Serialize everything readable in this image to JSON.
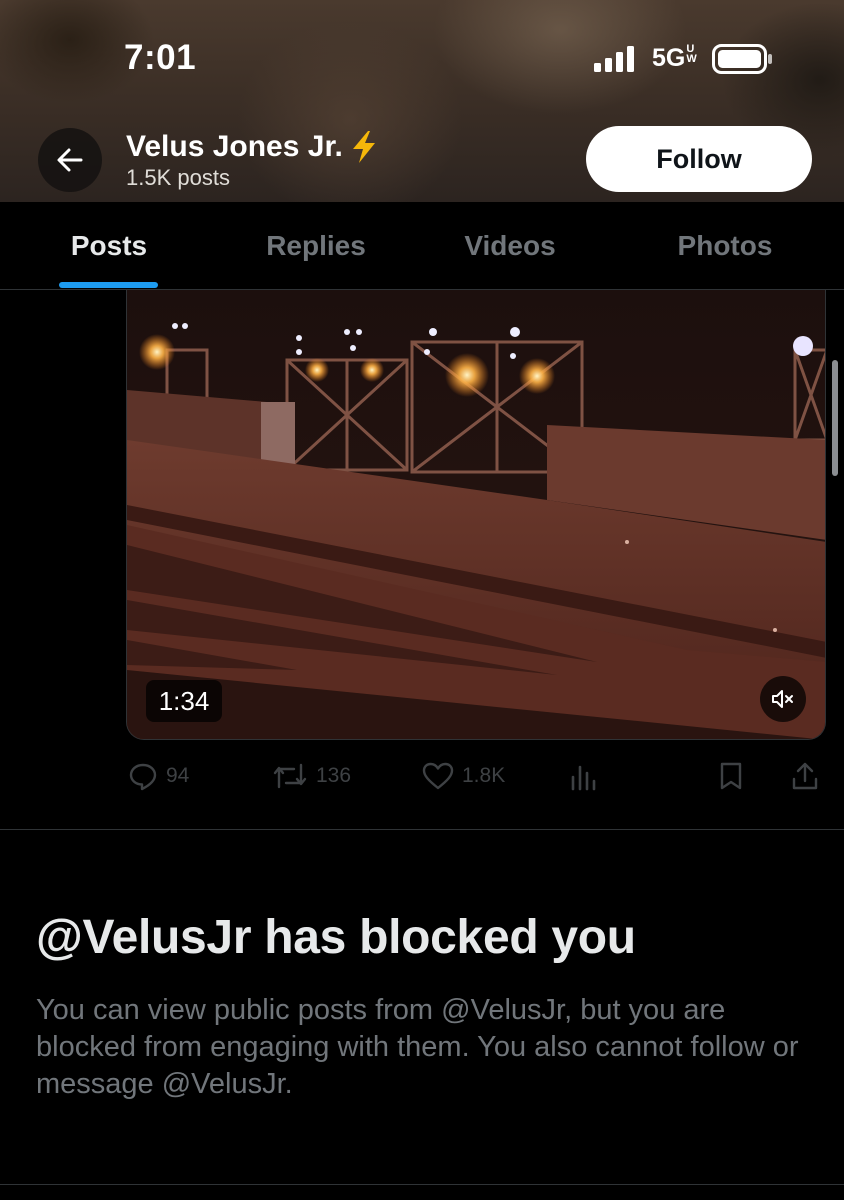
{
  "status_bar": {
    "time": "7:01",
    "network": "5G",
    "network_suffix": "UW"
  },
  "profile": {
    "name": "Velus Jones Jr.",
    "name_emoji": "⚡",
    "posts_count": "1.5K posts",
    "follow_label": "Follow"
  },
  "tabs": [
    {
      "label": "Posts",
      "active": true
    },
    {
      "label": "Replies",
      "active": false
    },
    {
      "label": "Videos",
      "active": false
    },
    {
      "label": "Photos",
      "active": false
    }
  ],
  "video": {
    "duration": "1:34",
    "muted": true
  },
  "actions": {
    "replies": "94",
    "reposts": "136",
    "likes": "1.8K"
  },
  "blocked": {
    "title": "@VelusJr has blocked you",
    "message": "You can view public posts from @VelusJr, but you are blocked from engaging with them. You also cannot follow or message @VelusJr."
  },
  "colors": {
    "accent": "#1d9bf0",
    "background": "#000000",
    "text_primary": "#e7e9ea",
    "text_secondary": "#71767b"
  }
}
